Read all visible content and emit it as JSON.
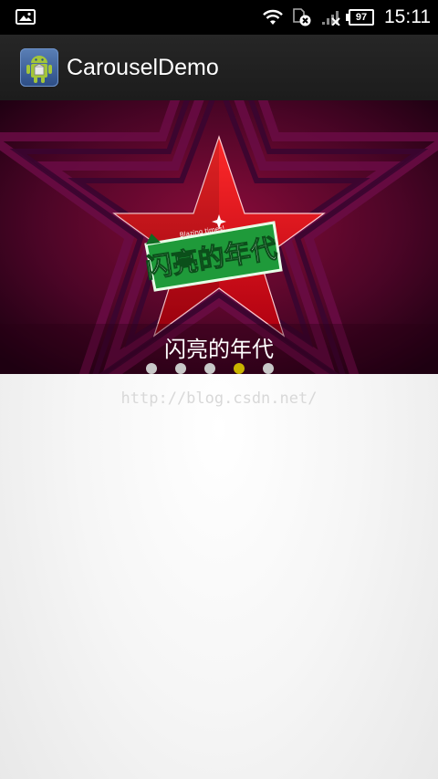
{
  "status_bar": {
    "time": "15:11",
    "battery": "97",
    "icons": [
      "image-notification-icon",
      "wifi-icon",
      "sim-error-icon",
      "signal-icon",
      "battery-icon"
    ]
  },
  "action_bar": {
    "title": "CarouselDemo",
    "icon": "android-app-icon"
  },
  "carousel": {
    "slide_logo_text": "闪亮的年代",
    "slide_logo_small_text": "Blazing times!",
    "caption": "闪亮的年代",
    "page_count": 5,
    "current_page": 4,
    "colors": {
      "active_dot": "#c9b400",
      "inactive_dot": "#c8c8c8",
      "star": "#e0141b",
      "banner": "#1f9a3a"
    }
  },
  "watermark": "http://blog.csdn.net/"
}
